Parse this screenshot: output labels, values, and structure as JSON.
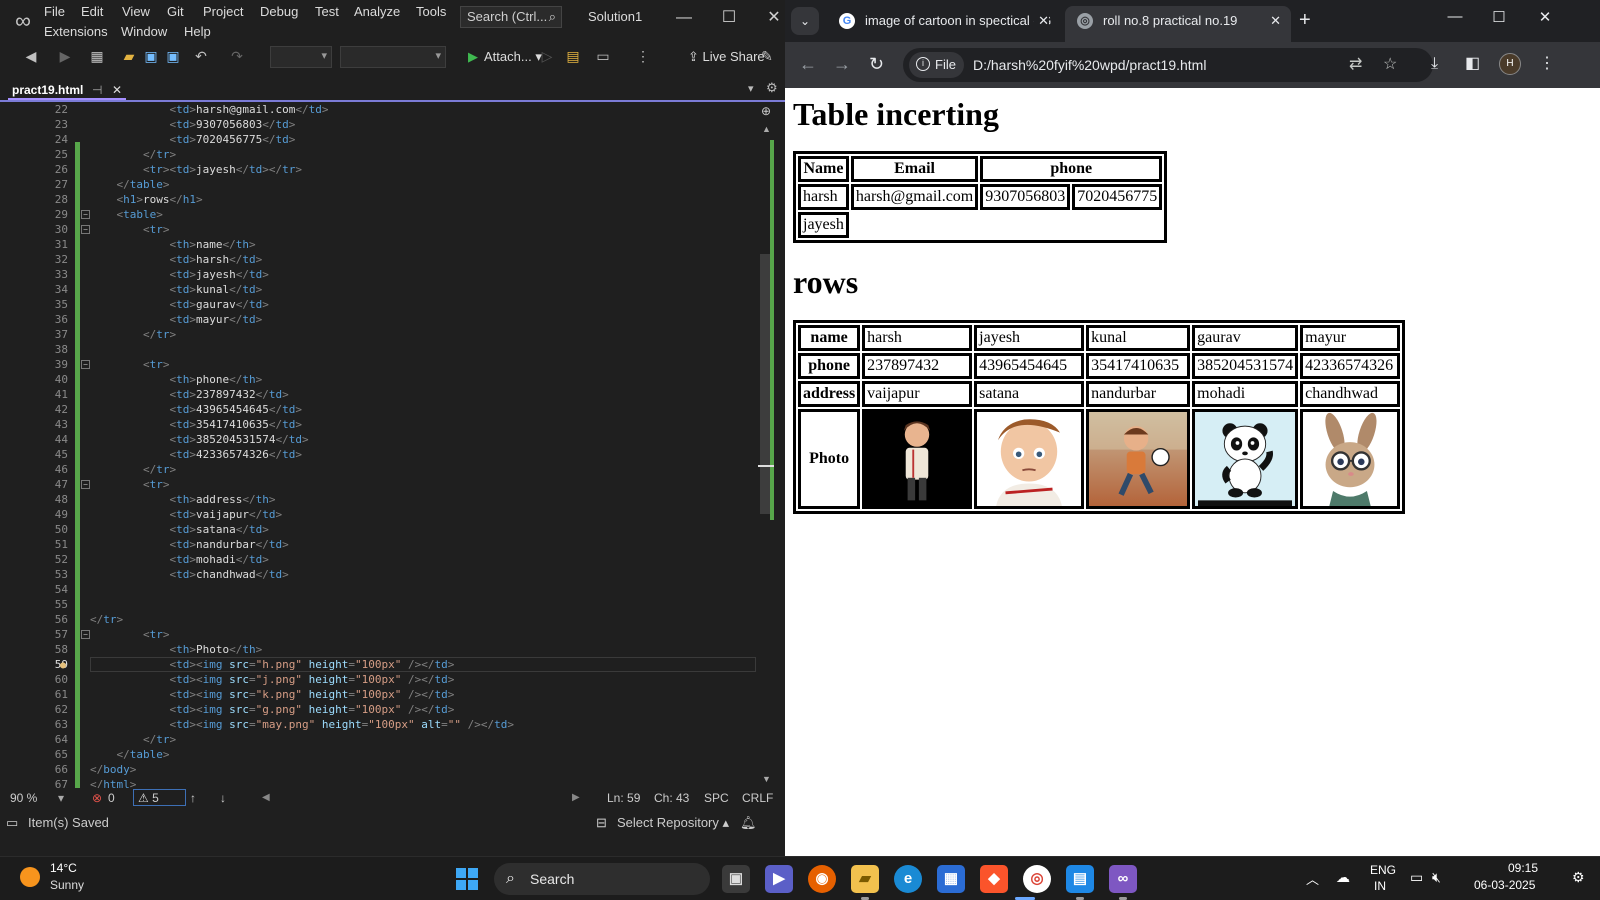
{
  "vs": {
    "menu": [
      "File",
      "Edit",
      "View",
      "Git",
      "Project",
      "Debug",
      "Test",
      "Analyze",
      "Tools",
      "Extensions",
      "Window",
      "Help"
    ],
    "search_placeholder": "Search (Ctrl...",
    "solution_name": "Solution1",
    "toolbar": {
      "attach_label": "Attach...",
      "liveshare_label": "Live Share"
    },
    "tab": {
      "filename": "pract19.html"
    },
    "code": [
      {
        "n": "22",
        "c": "            <td>harsh@gmail.com</td>"
      },
      {
        "n": "23",
        "c": "            <td>9307056803</td>"
      },
      {
        "n": "24",
        "c": "            <td>7020456775</td>"
      },
      {
        "n": "25",
        "c": "        </tr>"
      },
      {
        "n": "26",
        "c": "        <tr><td>jayesh</td></tr>"
      },
      {
        "n": "27",
        "c": "    </table>"
      },
      {
        "n": "28",
        "c": "    <h1>rows</h1>"
      },
      {
        "n": "29",
        "c": "    <table>"
      },
      {
        "n": "30",
        "c": "        <tr>"
      },
      {
        "n": "31",
        "c": "            <th>name</th>"
      },
      {
        "n": "32",
        "c": "            <td>harsh</td>"
      },
      {
        "n": "33",
        "c": "            <td>jayesh</td>"
      },
      {
        "n": "34",
        "c": "            <td>kunal</td>"
      },
      {
        "n": "35",
        "c": "            <td>gaurav</td>"
      },
      {
        "n": "36",
        "c": "            <td>mayur</td>"
      },
      {
        "n": "37",
        "c": "        </tr>"
      },
      {
        "n": "38",
        "c": ""
      },
      {
        "n": "39",
        "c": "        <tr>"
      },
      {
        "n": "40",
        "c": "            <th>phone</th>"
      },
      {
        "n": "41",
        "c": "            <td>237897432</td>"
      },
      {
        "n": "42",
        "c": "            <td>43965454645</td>"
      },
      {
        "n": "43",
        "c": "            <td>35417410635</td>"
      },
      {
        "n": "44",
        "c": "            <td>385204531574</td>"
      },
      {
        "n": "45",
        "c": "            <td>42336574326</td>"
      },
      {
        "n": "46",
        "c": "        </tr>"
      },
      {
        "n": "47",
        "c": "        <tr>"
      },
      {
        "n": "48",
        "c": "            <th>address</th>"
      },
      {
        "n": "49",
        "c": "            <td>vaijapur</td>"
      },
      {
        "n": "50",
        "c": "            <td>satana</td>"
      },
      {
        "n": "51",
        "c": "            <td>nandurbar</td>"
      },
      {
        "n": "52",
        "c": "            <td>mohadi</td>"
      },
      {
        "n": "53",
        "c": "            <td>chandhwad</td>"
      },
      {
        "n": "54",
        "c": ""
      },
      {
        "n": "55",
        "c": ""
      },
      {
        "n": "56",
        "c": "</tr>"
      },
      {
        "n": "57",
        "c": "        <tr>"
      },
      {
        "n": "58",
        "c": "            <th>Photo</th>"
      },
      {
        "n": "59",
        "c": "            <td><img src=\"h.png\" height=\"100px\" /></td>"
      },
      {
        "n": "60",
        "c": "            <td><img src=\"j.png\" height=\"100px\" /></td>"
      },
      {
        "n": "61",
        "c": "            <td><img src=\"k.png\" height=\"100px\" /></td>"
      },
      {
        "n": "62",
        "c": "            <td><img src=\"g.png\" height=\"100px\" /></td>"
      },
      {
        "n": "63",
        "c": "            <td><img src=\"may.png\" height=\"100px\" alt=\"\" /></td>"
      },
      {
        "n": "64",
        "c": "        </tr>"
      },
      {
        "n": "65",
        "c": "    </table>"
      },
      {
        "n": "66",
        "c": "</body>"
      },
      {
        "n": "67",
        "c": "</html>"
      }
    ],
    "current_line": "59",
    "status": {
      "zoom": "90 %",
      "errors": "0",
      "warnings": "5",
      "ln": "Ln: 59",
      "ch": "Ch: 43",
      "spc": "SPC",
      "eol": "CRLF",
      "message": "Item(s) Saved",
      "repo": "Select Repository"
    }
  },
  "chrome": {
    "tabs": [
      {
        "title": "image of cartoon in spectical - G",
        "active": false
      },
      {
        "title": "roll no.8 practical no.19",
        "active": true
      }
    ],
    "file_chip": "File",
    "url": "D:/harsh%20fyif%20wpd/pract19.html",
    "page": {
      "heading1": "Table incerting",
      "table1": {
        "headers": [
          "Name",
          "Email",
          "phone"
        ],
        "rows": [
          [
            "harsh",
            "harsh@gmail.com",
            "9307056803",
            "7020456775"
          ],
          [
            "jayesh"
          ]
        ]
      },
      "heading2": "rows",
      "table2": {
        "rows": [
          {
            "label": "name",
            "cells": [
              "harsh",
              "jayesh",
              "kunal",
              "gaurav",
              "mayur"
            ]
          },
          {
            "label": "phone",
            "cells": [
              "237897432",
              "43965454645",
              "35417410635",
              "385204531574",
              "42336574326"
            ]
          },
          {
            "label": "address",
            "cells": [
              "vaijapur",
              "satana",
              "nandurbar",
              "mohadi",
              "chandhwad"
            ]
          }
        ],
        "photo_label": "Photo",
        "photos": [
          "boy-cartoon-image",
          "boy-cartoon-closeup-image",
          "running-boy-cartoon-image",
          "panda-cartoon-image",
          "rabbit-with-glasses-image"
        ]
      }
    }
  },
  "taskbar": {
    "temp": "14°C",
    "condition": "Sunny",
    "search_label": "Search",
    "lang1": "ENG",
    "lang2": "IN",
    "time": "09:15",
    "date": "06-03-2025"
  }
}
